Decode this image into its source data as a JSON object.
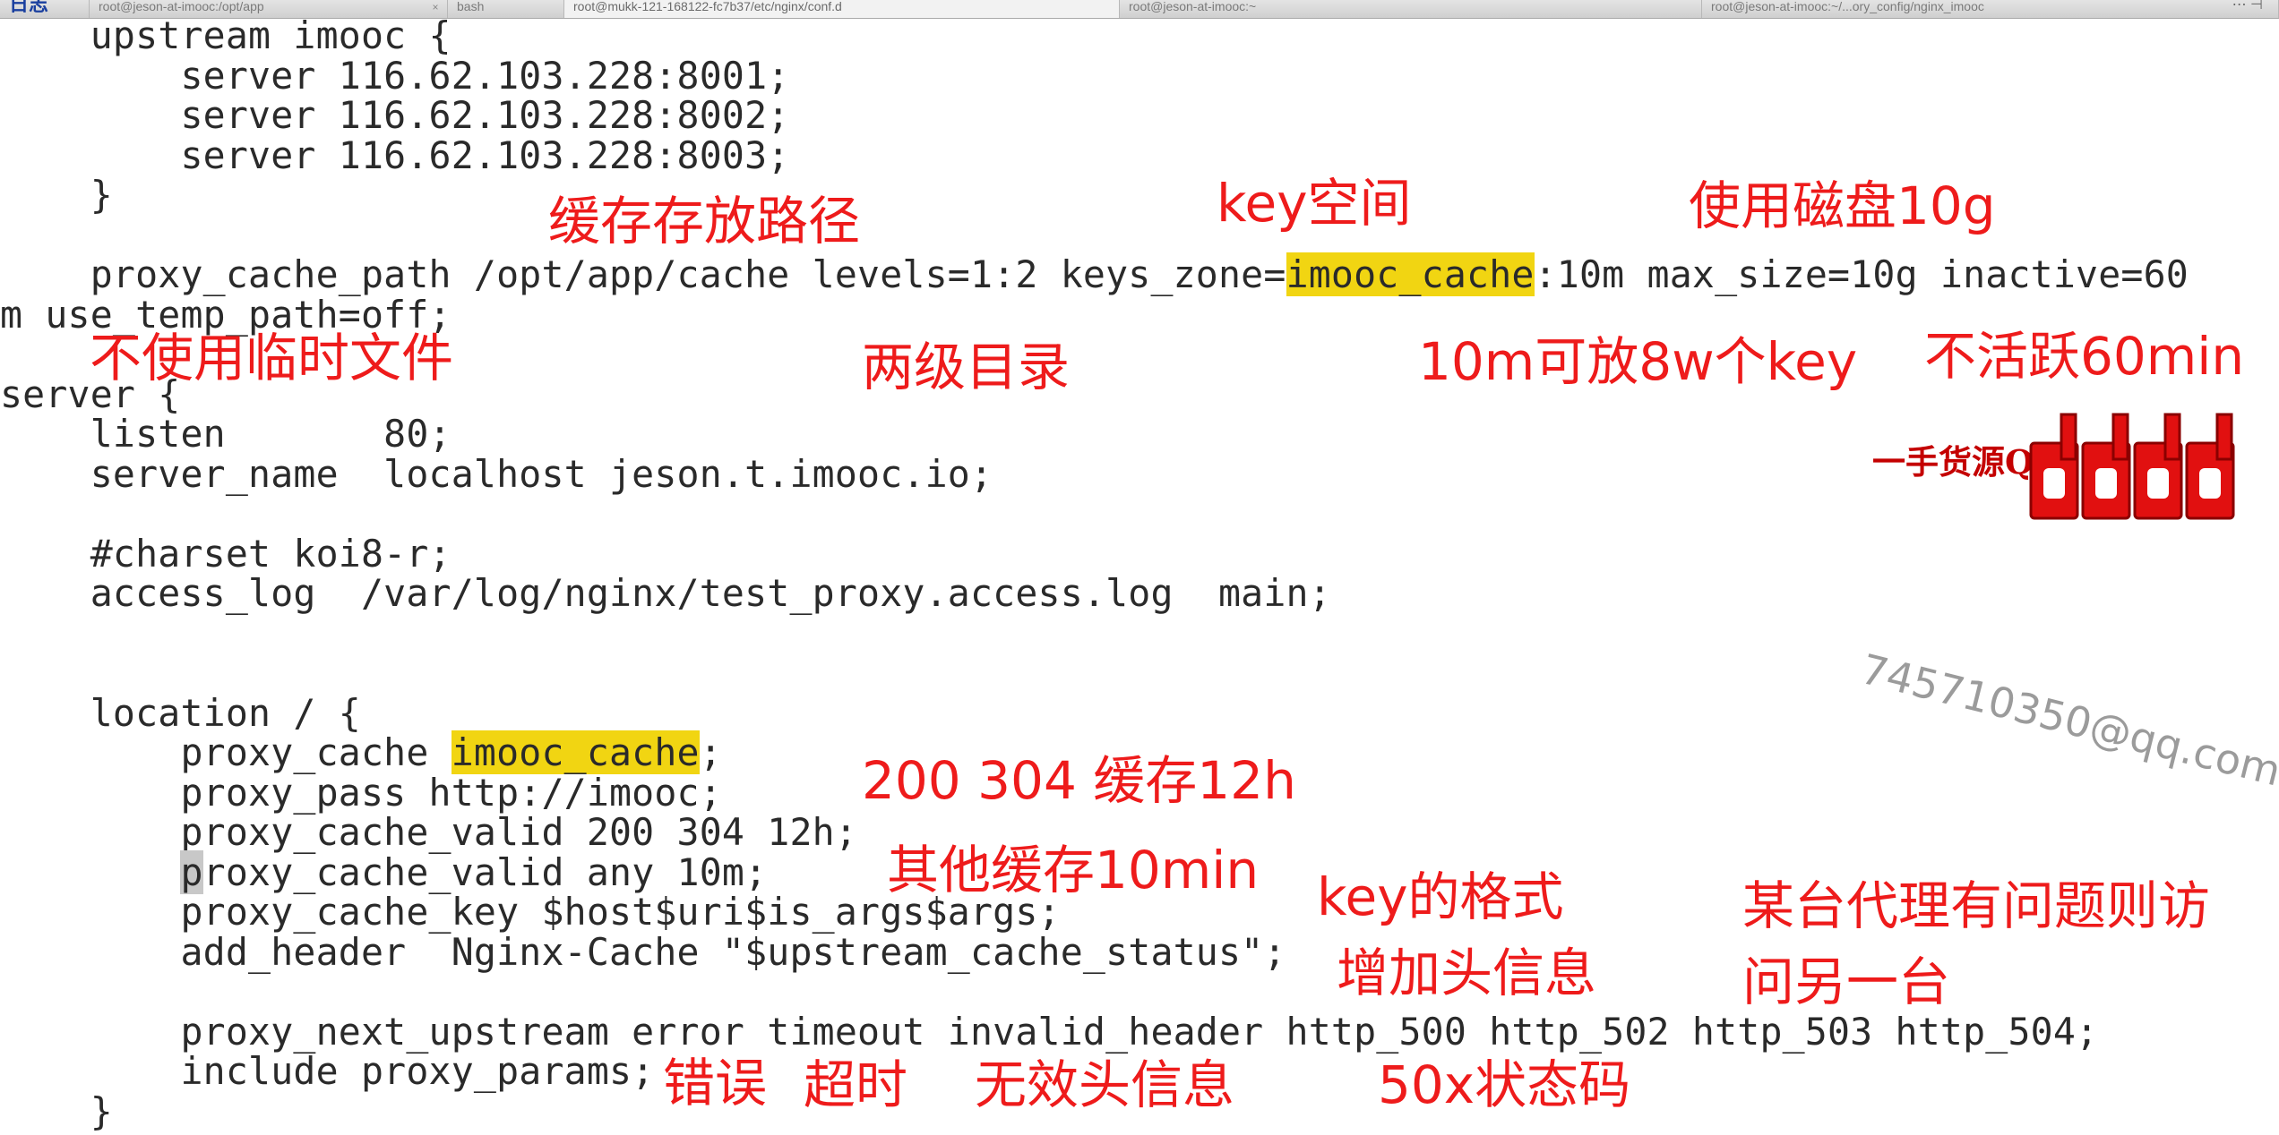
{
  "tabs": [
    {
      "label": "日志",
      "active": false
    },
    {
      "label": "root@jeson-at-imooc:/opt/app",
      "active": false
    },
    {
      "label": "bash",
      "active": false
    },
    {
      "label": "root@mukk-121-168122-fc7b37/etc/nginx/conf.d",
      "active": true
    },
    {
      "label": "root@jeson-at-imooc:~",
      "active": false
    },
    {
      "label": "root@jeson-at-imooc:~/...ory_config/nginx_imooc",
      "active": false
    }
  ],
  "code_lines": [
    "    upstream imooc {",
    "        server 116.62.103.228:8001;",
    "        server 116.62.103.228:8002;",
    "        server 116.62.103.228:8003;",
    "    }",
    "",
    "    proxy_cache_path /opt/app/cache levels=1:2 keys_zone=",
    "m use_temp_path=off;",
    "",
    "server {",
    "    listen       80;",
    "    server_name  localhost jeson.t.imooc.io;",
    "",
    "    #charset koi8-r;",
    "    access_log  /var/log/nginx/test_proxy.access.log  main;",
    "",
    "",
    "    location / {",
    "        proxy_cache ",
    "        proxy_pass http://imooc;",
    "        proxy_cache_valid 200 304 12h;",
    "        ",
    "        proxy_cache_key $host$uri$is_args$args;",
    "        add_header  Nginx-Cache \"$upstream_cache_status\";",
    "",
    "        proxy_next_upstream error timeout invalid_header http_500 http_502 http_503 http_504;",
    "        include proxy_params;",
    "    }"
  ],
  "highlight": {
    "zone_name": "imooc_cache",
    "line6_after": ":10m max_size=10g inactive=60",
    "line18_after": ";"
  },
  "cursor_line": {
    "cursor_char": "p",
    "rest": "roxy_cache_valid any 10m;"
  },
  "annotations": {
    "cache_path": "缓存存放路径",
    "key_space": "key空间",
    "disk_usage": "使用磁盘10g",
    "no_temp_file": "不使用临时文件",
    "two_level_dir": "两级目录",
    "key_capacity": "10m可放8w个key",
    "inactive": "不活跃60min",
    "valid_200_304": "200 304 缓存12h",
    "valid_other": "其他缓存10min",
    "key_format": "key的格式",
    "add_header": "增加头信息",
    "failover_line1": "某台代理有问题则访",
    "failover_line2": "问另一台",
    "err_error": "错误",
    "err_timeout": "超时",
    "err_invalid_header": "无效头信息",
    "err_50x": "50x状态码"
  },
  "watermarks": {
    "source_text": "一手货源Q",
    "email": "745710350@qq.com"
  },
  "colors": {
    "annotation": "#ee1b1b",
    "highlight": "#f1d512",
    "code_text": "#2a2a2a",
    "tab_label_accent": "#1a3f9f"
  }
}
